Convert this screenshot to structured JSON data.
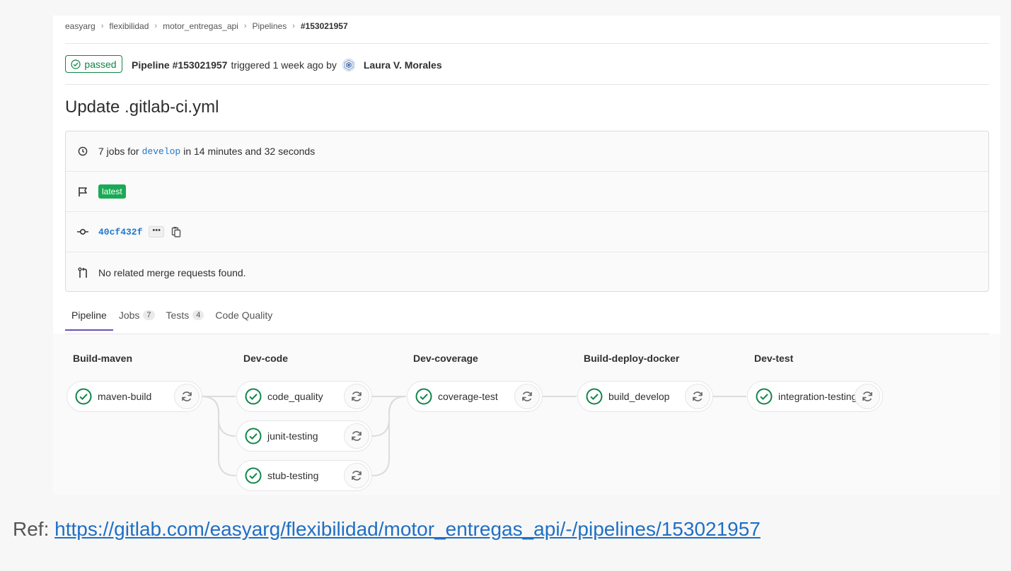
{
  "breadcrumb": [
    "easyarg",
    "flexibilidad",
    "motor_entregas_api",
    "Pipelines",
    "#153021957"
  ],
  "header": {
    "status": "passed",
    "pipeline_label": "Pipeline #153021957",
    "triggered_text": "triggered 1 week ago by",
    "user": "Laura V. Morales"
  },
  "title": "Update .gitlab-ci.yml",
  "info": {
    "jobs_prefix": "7 jobs for",
    "branch": "develop",
    "duration": "in 14 minutes and 32 seconds",
    "latest_badge": "latest",
    "commit_sha": "40cf432f",
    "ellipsis": "•••",
    "merge_requests": "No related merge requests found."
  },
  "tabs": [
    {
      "label": "Pipeline",
      "count": null
    },
    {
      "label": "Jobs",
      "count": "7"
    },
    {
      "label": "Tests",
      "count": "4"
    },
    {
      "label": "Code Quality",
      "count": null
    }
  ],
  "stages": [
    {
      "name": "Build-maven",
      "jobs": [
        "maven-build"
      ]
    },
    {
      "name": "Dev-code",
      "jobs": [
        "code_quality",
        "junit-testing",
        "stub-testing"
      ]
    },
    {
      "name": "Dev-coverage",
      "jobs": [
        "coverage-test"
      ]
    },
    {
      "name": "Build-deploy-docker",
      "jobs": [
        "build_develop"
      ]
    },
    {
      "name": "Dev-test",
      "jobs": [
        "integration-testing"
      ]
    }
  ],
  "reference": {
    "prefix": "Ref:",
    "url": "https://gitlab.com/easyarg/flexibilidad/motor_entregas_api/-/pipelines/153021957"
  },
  "colors": {
    "success": "#108548",
    "link": "#1f78d1",
    "active_tab": "#6b4fbb",
    "latest_badge": "#1aaa55"
  },
  "icons": {
    "status": "check-circle-icon",
    "clock": "clock-icon",
    "flag": "flag-icon",
    "commit": "commit-icon",
    "merge_request": "merge-request-icon",
    "retry": "retry-icon",
    "copy": "copy-icon"
  }
}
